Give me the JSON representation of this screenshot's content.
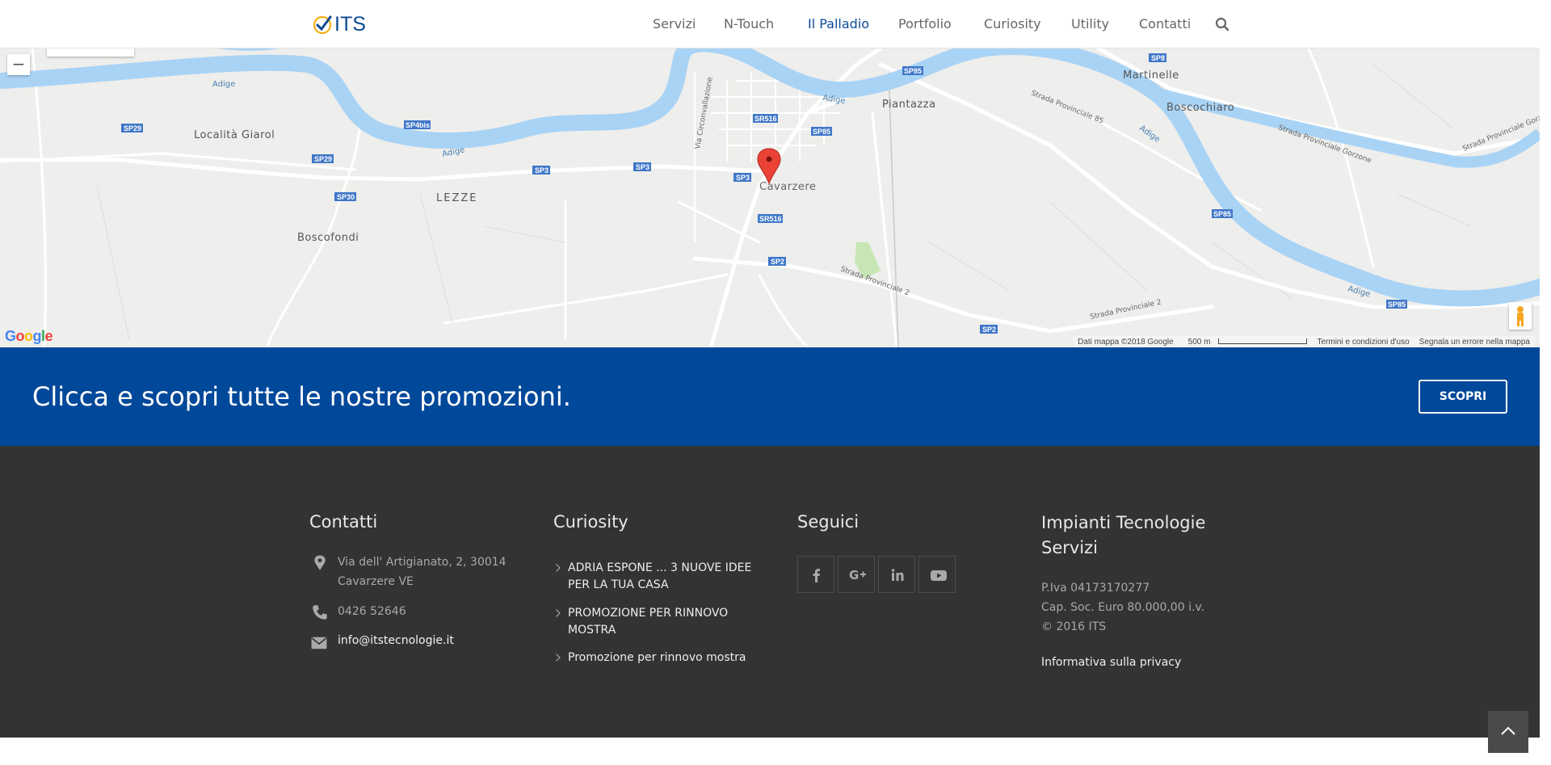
{
  "header": {
    "logo_text": "ITS",
    "nav": [
      {
        "label": "Servizi",
        "active": false
      },
      {
        "label": "N-Touch",
        "active": false
      },
      {
        "label": "Il Palladio",
        "active": true
      },
      {
        "label": "Portfolio",
        "active": false
      },
      {
        "label": "Curiosity",
        "active": false
      },
      {
        "label": "Utility",
        "active": false
      },
      {
        "label": "Contatti",
        "active": false
      }
    ],
    "search_icon": "search-icon"
  },
  "map": {
    "zoom_out_label": "−",
    "place_labels": [
      "Località Giarol",
      "LEZZE",
      "Boscofondi",
      "Cavarzere",
      "Piantazza",
      "Martinelle",
      "Boscochiaro"
    ],
    "river_labels": [
      "Adige",
      "Adige",
      "Adige",
      "Adige",
      "Adige"
    ],
    "road_labels": [
      "SP29",
      "SP4bis",
      "SP29",
      "SP30",
      "SP3",
      "SP3",
      "SP3",
      "SR516",
      "SP85",
      "SR516",
      "SP2",
      "SP2",
      "SP85",
      "SP8",
      "SP85",
      "SP85"
    ],
    "road_names": [
      "Via Circonvallazione",
      "Strada Provinciale 2",
      "Strada Provinciale 2",
      "Strada Provinciale 85",
      "Strada Provinciale Gorzone",
      "Strada Provinciale Gorzo"
    ],
    "google_logo": "Google",
    "attribution": "Dati mappa ©2018 Google",
    "scale": "500 m",
    "terms": "Termini e condizioni d'uso",
    "report": "Segnala un errore nella mappa",
    "marker_icon": "map-marker-icon",
    "pegman_icon": "pegman-icon"
  },
  "promo": {
    "text": "Clicca e scopri tutte le nostre promozioni.",
    "button": "SCOPRI"
  },
  "footer": {
    "contatti": {
      "title": "Contatti",
      "address_line1": "Via dell' Artigianato, 2, 30014",
      "address_line2": "Cavarzere VE",
      "phone": "0426 52646",
      "email": "info@itstecnologie.it"
    },
    "curiosity": {
      "title": "Curiosity",
      "items": [
        {
          "line1": "ADRIA ESPONE ... 3 NUOVE IDEE",
          "line2": "PER LA TUA CASA"
        },
        {
          "line1": "PROMOZIONE PER RINNOVO",
          "line2": "MOSTRA"
        },
        {
          "line1": "Promozione per rinnovo mostra",
          "line2": ""
        }
      ]
    },
    "seguici": {
      "title": "Seguici",
      "socials": [
        "facebook-icon",
        "google-plus-icon",
        "linkedin-icon",
        "youtube-icon"
      ]
    },
    "its": {
      "title_line1": "Impianti Tecnologie",
      "title_line2": "Servizi",
      "piva": "P.Iva 04173170277",
      "capitale": "Cap. Soc. Euro 80.000,00 i.v.",
      "copyright": "© 2016 ITS",
      "privacy": "Informativa sulla privacy"
    }
  },
  "colors": {
    "brand_blue": "#00489a",
    "nav_active": "#0c4b98",
    "footer_bg": "#333333",
    "river": "#a9d3f5",
    "marker": "#ea4335"
  }
}
